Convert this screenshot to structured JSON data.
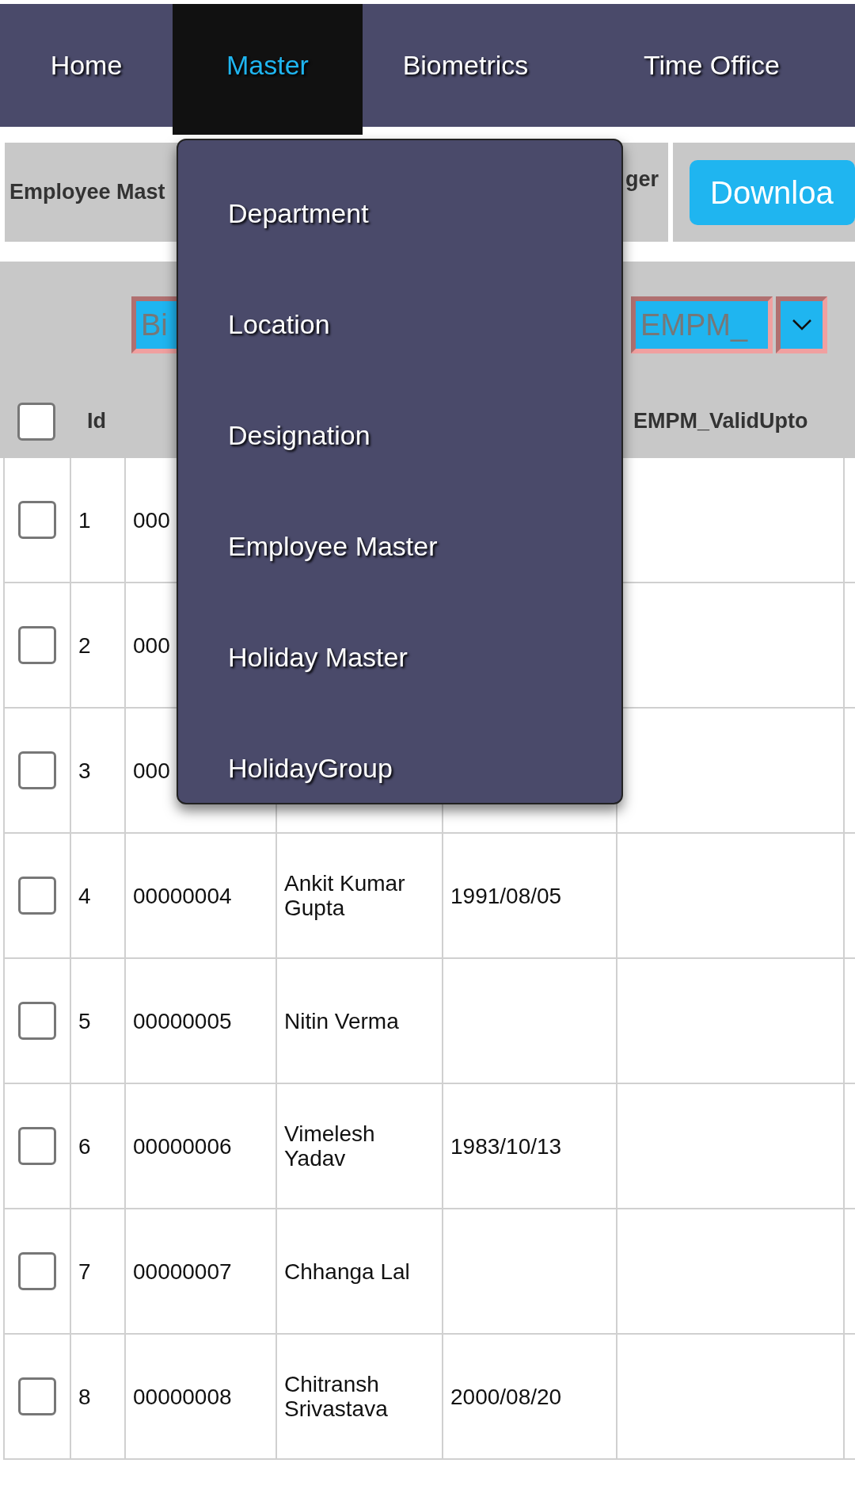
{
  "nav": {
    "tabs": [
      {
        "label": "Home",
        "selected": false
      },
      {
        "label": "Master",
        "selected": true
      },
      {
        "label": "Biometrics",
        "selected": false
      },
      {
        "label": "Time Office",
        "selected": false
      }
    ]
  },
  "toolbar": [
    {
      "kind": "label",
      "text": "Employee Mast"
    },
    {
      "kind": "label",
      "text": "ger"
    },
    {
      "kind": "button",
      "text": "Downloa"
    }
  ],
  "filters": [
    {
      "kind": "field",
      "value": "Bi"
    },
    {
      "kind": "field",
      "value": "EMPM_"
    },
    {
      "kind": "dropdown"
    }
  ],
  "table": {
    "header": {
      "checked": false,
      "id": "Id",
      "column_6": "EMPM_ValidUpto"
    },
    "rows": [
      {
        "checked": false,
        "id": "1",
        "code": "000"
      },
      {
        "checked": false,
        "id": "2",
        "code": "000"
      },
      {
        "checked": false,
        "id": "3",
        "code": "000"
      },
      {
        "checked": false,
        "id": "4",
        "code": "00000004",
        "name": "Ankit Kumar Gupta",
        "date": "1991/08/05"
      },
      {
        "checked": false,
        "id": "5",
        "code": "00000005",
        "name": "Nitin Verma"
      },
      {
        "checked": false,
        "id": "6",
        "code": "00000006",
        "name": "Vimelesh Yadav",
        "date": "1983/10/13"
      },
      {
        "checked": false,
        "id": "7",
        "code": "00000007",
        "name": "Chhanga Lal"
      },
      {
        "checked": false,
        "id": "8",
        "code": "00000008",
        "name": "Chitransh Srivastava",
        "date": "2000/08/20"
      }
    ]
  },
  "menu": {
    "items": [
      "Department",
      "Location",
      "Designation",
      "Employee Master",
      "Holiday Master",
      "HolidayGroup"
    ]
  }
}
